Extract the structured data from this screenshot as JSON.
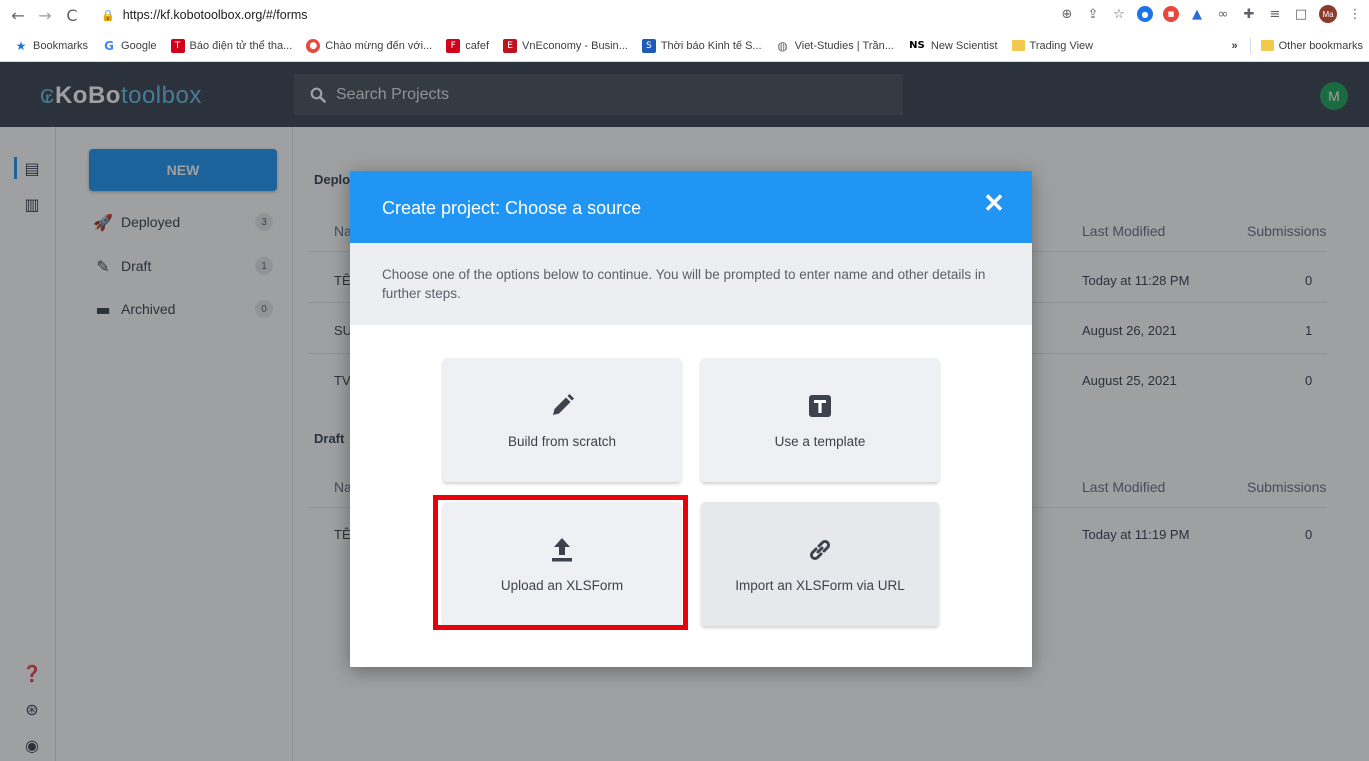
{
  "browser": {
    "url": "https://kf.kobotoolbox.org/#/forms",
    "bookmarks": [
      {
        "label": "Bookmarks",
        "icon": "star-icon"
      },
      {
        "label": "Google",
        "icon": "google-icon"
      },
      {
        "label": "Báo điện tử thể tha...",
        "icon": "news-icon"
      },
      {
        "label": "Chào mừng đến với...",
        "icon": "site-icon"
      },
      {
        "label": "cafef",
        "icon": "cafef-icon"
      },
      {
        "label": "VnEconomy - Busin...",
        "icon": "vneconomy-icon"
      },
      {
        "label": "Thời báo Kinh tế S...",
        "icon": "tbkt-icon"
      },
      {
        "label": "Viet-Studies | Trần...",
        "icon": "globe-icon"
      },
      {
        "label": "New Scientist",
        "icon": "ns-icon"
      },
      {
        "label": "Trading View",
        "icon": "folder-icon"
      }
    ],
    "overflow": "»",
    "other_bookmarks": "Other bookmarks",
    "profile": "Ma"
  },
  "app": {
    "logo_kobo": "KoBo",
    "logo_toolbox": "toolbox",
    "search_placeholder": "Search Projects",
    "user_initial": "M"
  },
  "sidebar": {
    "new_label": "NEW",
    "items": [
      {
        "label": "Deployed",
        "count": "3"
      },
      {
        "label": "Draft",
        "count": "1"
      },
      {
        "label": "Archived",
        "count": "0"
      }
    ]
  },
  "main": {
    "deployed_section": "Deplo",
    "draft_section": "Draft",
    "col_name": "Na",
    "col_modified": "Last Modified",
    "col_submissions": "Submissions",
    "deployed_rows": [
      {
        "name": "TÊ",
        "modified": "Today at 11:28 PM",
        "submissions": "0"
      },
      {
        "name": "SU",
        "modified": "August 26, 2021",
        "submissions": "1"
      },
      {
        "name": "TV",
        "modified": "August 25, 2021",
        "submissions": "0"
      }
    ],
    "draft_rows": [
      {
        "name": "TÊ",
        "modified": "Today at 11:19 PM",
        "submissions": "0"
      }
    ]
  },
  "modal": {
    "title": "Create project: Choose a source",
    "description": "Choose one of the options below to continue. You will be prompted to enter name and other details in further steps.",
    "options": [
      {
        "label": "Build from scratch",
        "icon": "pencil-icon"
      },
      {
        "label": "Use a template",
        "icon": "template-icon"
      },
      {
        "label": "Upload an XLSForm",
        "icon": "upload-icon"
      },
      {
        "label": "Import an XLSForm via URL",
        "icon": "link-icon"
      }
    ]
  },
  "colors": {
    "header_bg": "#3c434e",
    "accent": "#2095f3",
    "highlight": "#e8000b"
  }
}
